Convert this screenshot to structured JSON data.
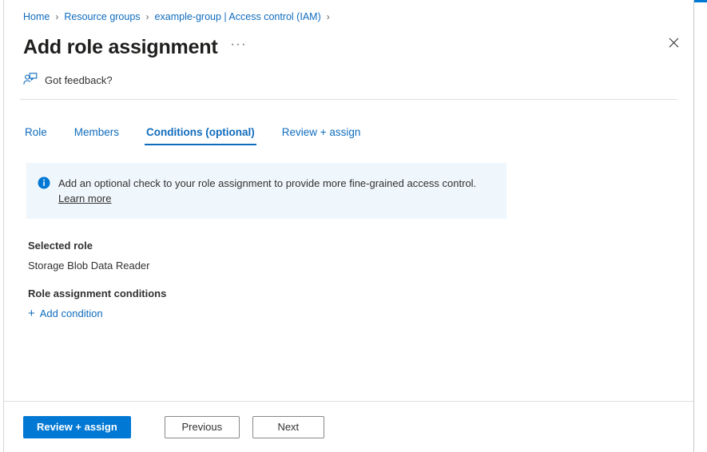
{
  "window": {
    "accent_color": "#0078d4",
    "close_icon": "close-icon"
  },
  "breadcrumb": {
    "separator": "›",
    "items": [
      {
        "label": "Home"
      },
      {
        "label": "Resource groups"
      },
      {
        "label": "example-group | Access control (IAM)"
      }
    ]
  },
  "header": {
    "title": "Add role assignment",
    "ellipsis": "···"
  },
  "feedback": {
    "icon": "feedback-person-icon",
    "label": "Got feedback?"
  },
  "tabs": [
    {
      "label": "Role",
      "active": false
    },
    {
      "label": "Members",
      "active": false
    },
    {
      "label": "Conditions (optional)",
      "active": true
    },
    {
      "label": "Review + assign",
      "active": false
    }
  ],
  "info_banner": {
    "icon": "info-circle-icon",
    "background": "#eff6fc",
    "text": "Add an optional check to your role assignment to provide more fine-grained access control. ",
    "link_label": "Learn more"
  },
  "main": {
    "selected_role_label": "Selected role",
    "selected_role_value": "Storage Blob Data Reader",
    "conditions_label": "Role assignment conditions",
    "add_condition_label": "Add condition",
    "add_condition_icon": "plus-icon",
    "add_condition_plus": "+"
  },
  "footer": {
    "primary_label": "Review + assign",
    "previous_label": "Previous",
    "next_label": "Next"
  }
}
